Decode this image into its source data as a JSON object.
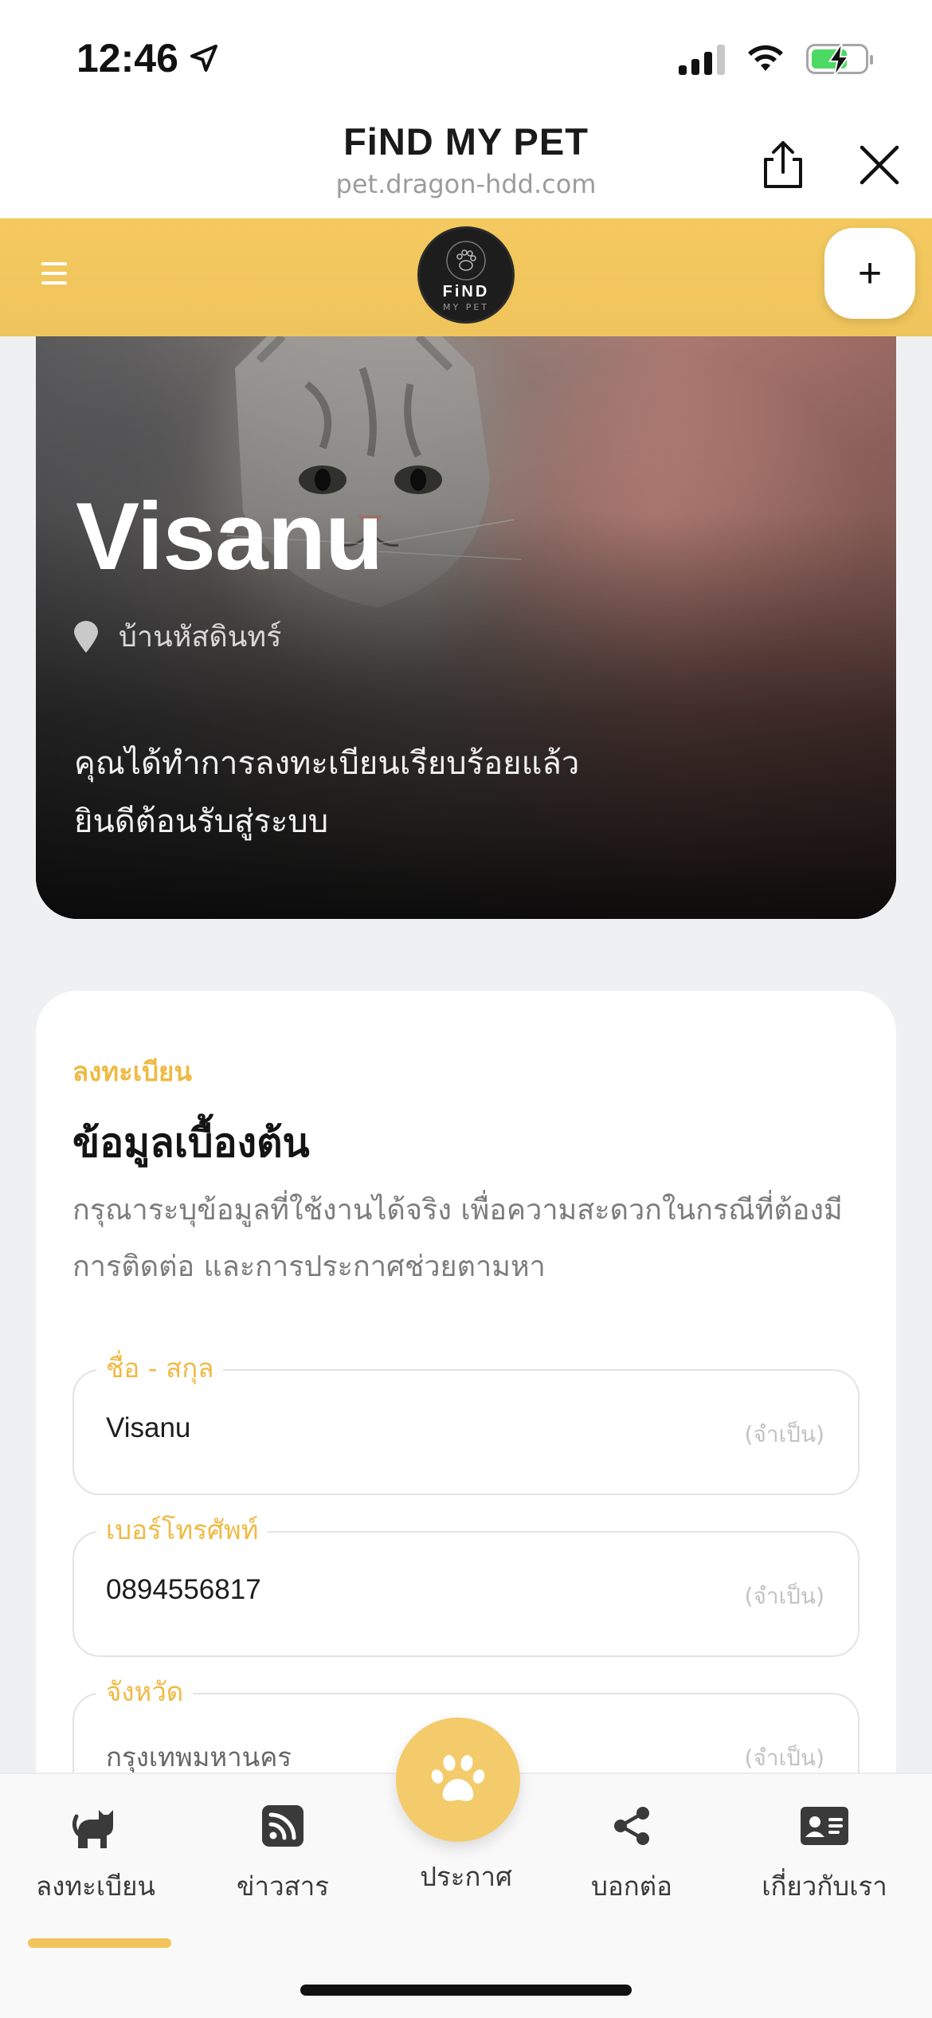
{
  "status_bar": {
    "time": "12:46",
    "icons": [
      "location-arrow-icon",
      "cellular-signal-icon",
      "wifi-icon",
      "battery-charging-icon"
    ]
  },
  "browser_sheet": {
    "title": "FiND MY PET",
    "url": "pet.dragon-hdd.com",
    "share_icon": "share-icon",
    "close_icon": "close-icon"
  },
  "app_header": {
    "menu_icon": "hamburger-menu-icon",
    "logo_text": "FiND",
    "logo_subtext": "MY PET",
    "add_label": "+",
    "accent_color": "#f2c75d"
  },
  "hero": {
    "name": "Visanu",
    "location": "บ้านหัสดินทร์",
    "message_line1": "คุณได้ทำการลงทะเบียนเรียบร้อยแล้ว",
    "message_line2": "ยินดีต้อนรับสู่ระบบ"
  },
  "form": {
    "eyebrow": "ลงทะเบียน",
    "title": "ข้อมูลเบื้องต้น",
    "description": "กรุณาระบุข้อมูลที่ใช้งานได้จริง เพื่อความสะดวกในกรณีที่ต้องมีการติดต่อ และการประกาศช่วยตามหา",
    "fields": [
      {
        "label": "ชื่อ - สกุล",
        "value": "Visanu",
        "required": "(จำเป็น)"
      },
      {
        "label": "เบอร์โทรศัพท์",
        "value": "0894556817",
        "required": "(จำเป็น)"
      },
      {
        "label": "จังหวัด",
        "value": "กรุงเทพมหานคร",
        "required": "(จำเป็น)"
      }
    ]
  },
  "bottom_nav": {
    "items": [
      {
        "label": "ลงทะเบียน",
        "icon": "cat-icon",
        "active": true
      },
      {
        "label": "ข่าวสาร",
        "icon": "rss-feed-icon",
        "active": false
      },
      {
        "label": "ประกาศ",
        "icon": "paw-icon",
        "active": false
      },
      {
        "label": "บอกต่อ",
        "icon": "share-nodes-icon",
        "active": false
      },
      {
        "label": "เกี่ยวกับเรา",
        "icon": "contact-card-icon",
        "active": false
      }
    ]
  }
}
